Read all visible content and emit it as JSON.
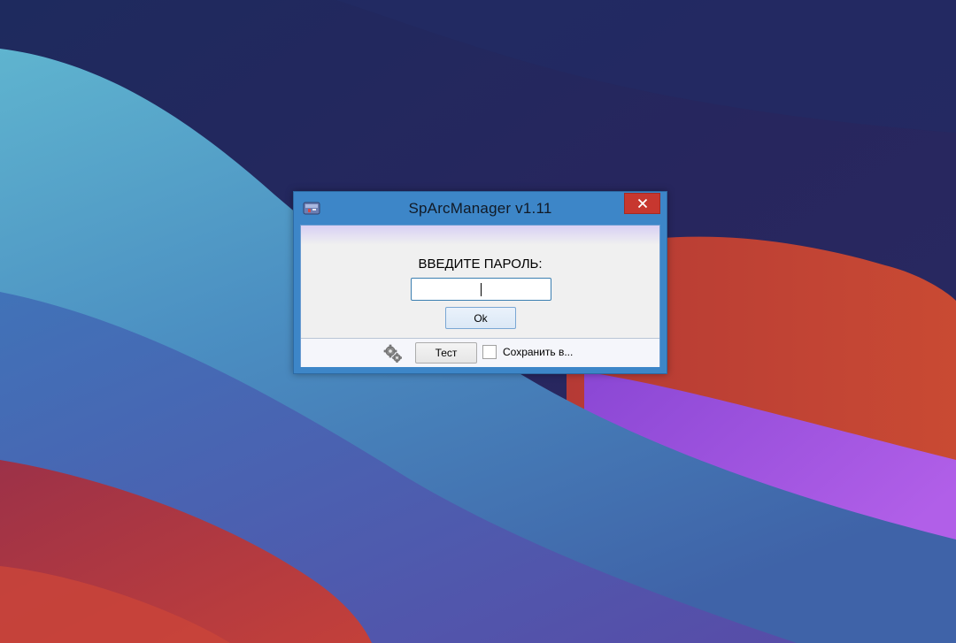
{
  "window": {
    "title": "SpArcManager v1.11",
    "close_glyph": "✕"
  },
  "dialog": {
    "prompt": "ВВЕДИТЕ ПАРОЛЬ:",
    "password_value": "",
    "ok_label": "Ok"
  },
  "footer": {
    "test_label": "Тест",
    "save_label": "Сохранить в...",
    "save_checked": false
  },
  "icons": {
    "app": "app-archive-icon",
    "settings": "gear-icon",
    "close": "close-icon"
  },
  "colors": {
    "titlebar": "#3d86c8",
    "close": "#c7372f",
    "client": "#f0f0f0"
  }
}
